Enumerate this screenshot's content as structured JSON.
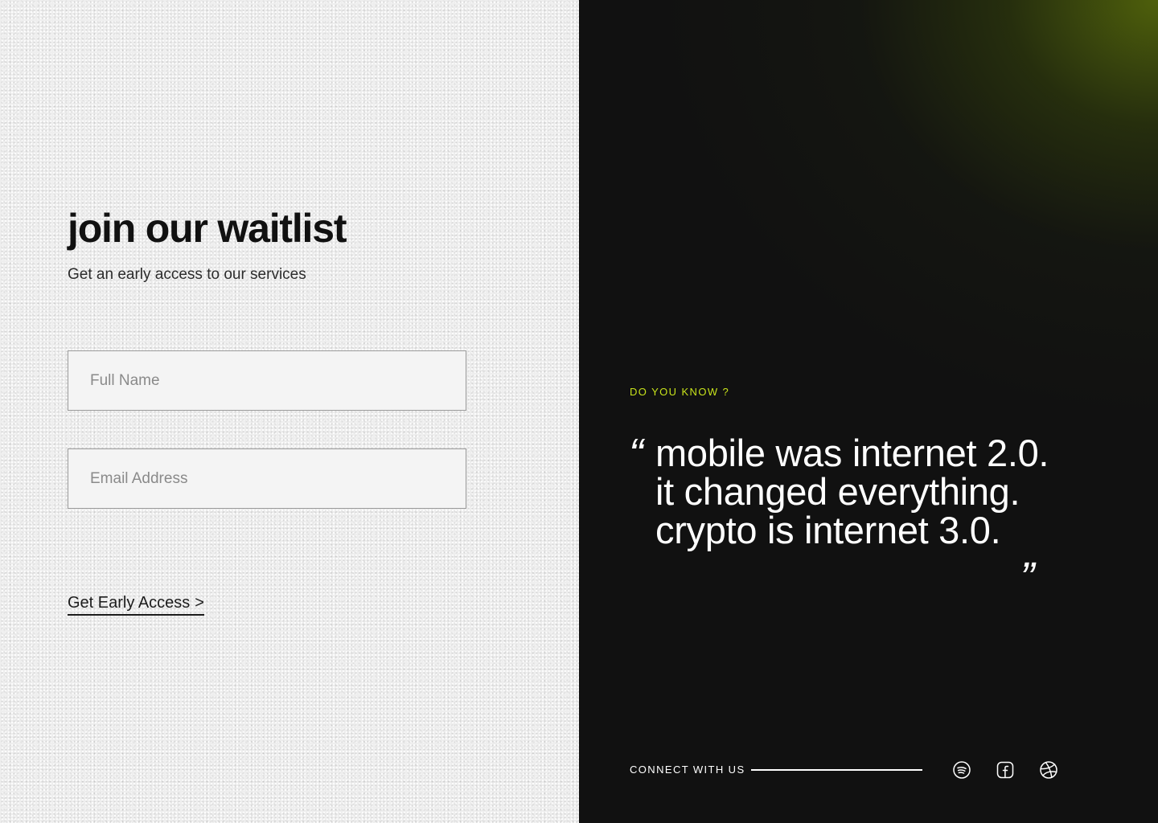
{
  "form": {
    "title": "join our waitlist",
    "subtitle": "Get an early access to our services",
    "name_placeholder": "Full Name",
    "email_placeholder": "Email Address",
    "cta_label": "Get Early Access",
    "cta_chevron": ">"
  },
  "quote": {
    "eyebrow": "DO YOU KNOW ?",
    "open_mark": "“",
    "lines": [
      "mobile was internet 2.0.",
      "it changed everything.",
      "crypto is internet 3.0."
    ],
    "close_mark": "„"
  },
  "footer": {
    "connect_label": "CONNECT WITH US",
    "social_icons": [
      "spotify-icon",
      "facebook-icon",
      "dribbble-icon"
    ]
  },
  "colors": {
    "accent": "#c7e21b",
    "dark_bg": "#111111",
    "light_bg": "#eeeeee"
  }
}
